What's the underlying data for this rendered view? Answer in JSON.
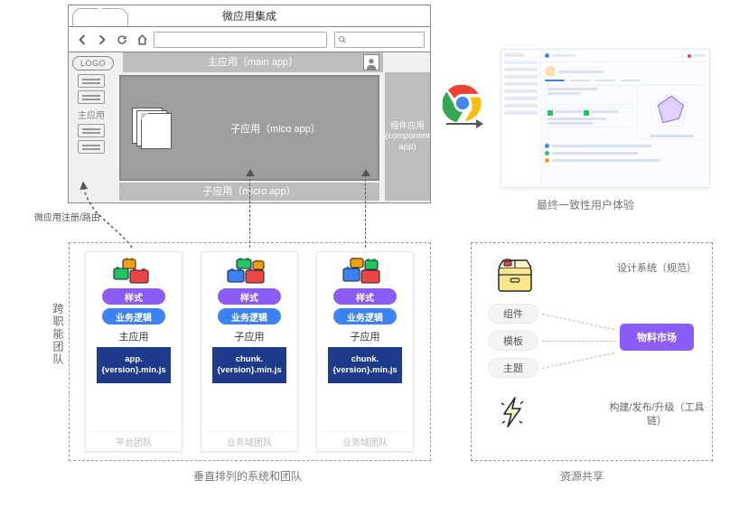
{
  "browser": {
    "title": "微应用集成",
    "logo": "LOGO",
    "main_app_label": "主应用（main app）",
    "mico_app_label": "子应用（mico app）",
    "micro_app_label": "子应用（micro app）",
    "component_app_label": "组件应用 (component app)",
    "sidebar_label": "主应用"
  },
  "reg_route": "微应用注册/路由",
  "result_caption": "最终一致性用户体验",
  "vertical_label": "跨职能团队",
  "bottom_caption_left": "垂直排列的系统和团队",
  "bottom_caption_right": "资源共享",
  "team_cols": [
    {
      "style": "样式",
      "logic": "业务逻辑",
      "name": "主应用",
      "bundle": "app.{version}.min.js",
      "team": "平台团队"
    },
    {
      "style": "样式",
      "logic": "业务逻辑",
      "name": "子应用",
      "bundle": "chunk.{version}.min.js",
      "team": "业务域团队"
    },
    {
      "style": "样式",
      "logic": "业务逻辑",
      "name": "子应用",
      "bundle": "chunk.{version}.min.js",
      "team": "业务域团队"
    }
  ],
  "ds": {
    "title": "设计系统（规范）",
    "pills": [
      "组件",
      "模板",
      "主题"
    ],
    "market": "物料市场",
    "toolchain": "构建/发布/升级（工具链）"
  }
}
